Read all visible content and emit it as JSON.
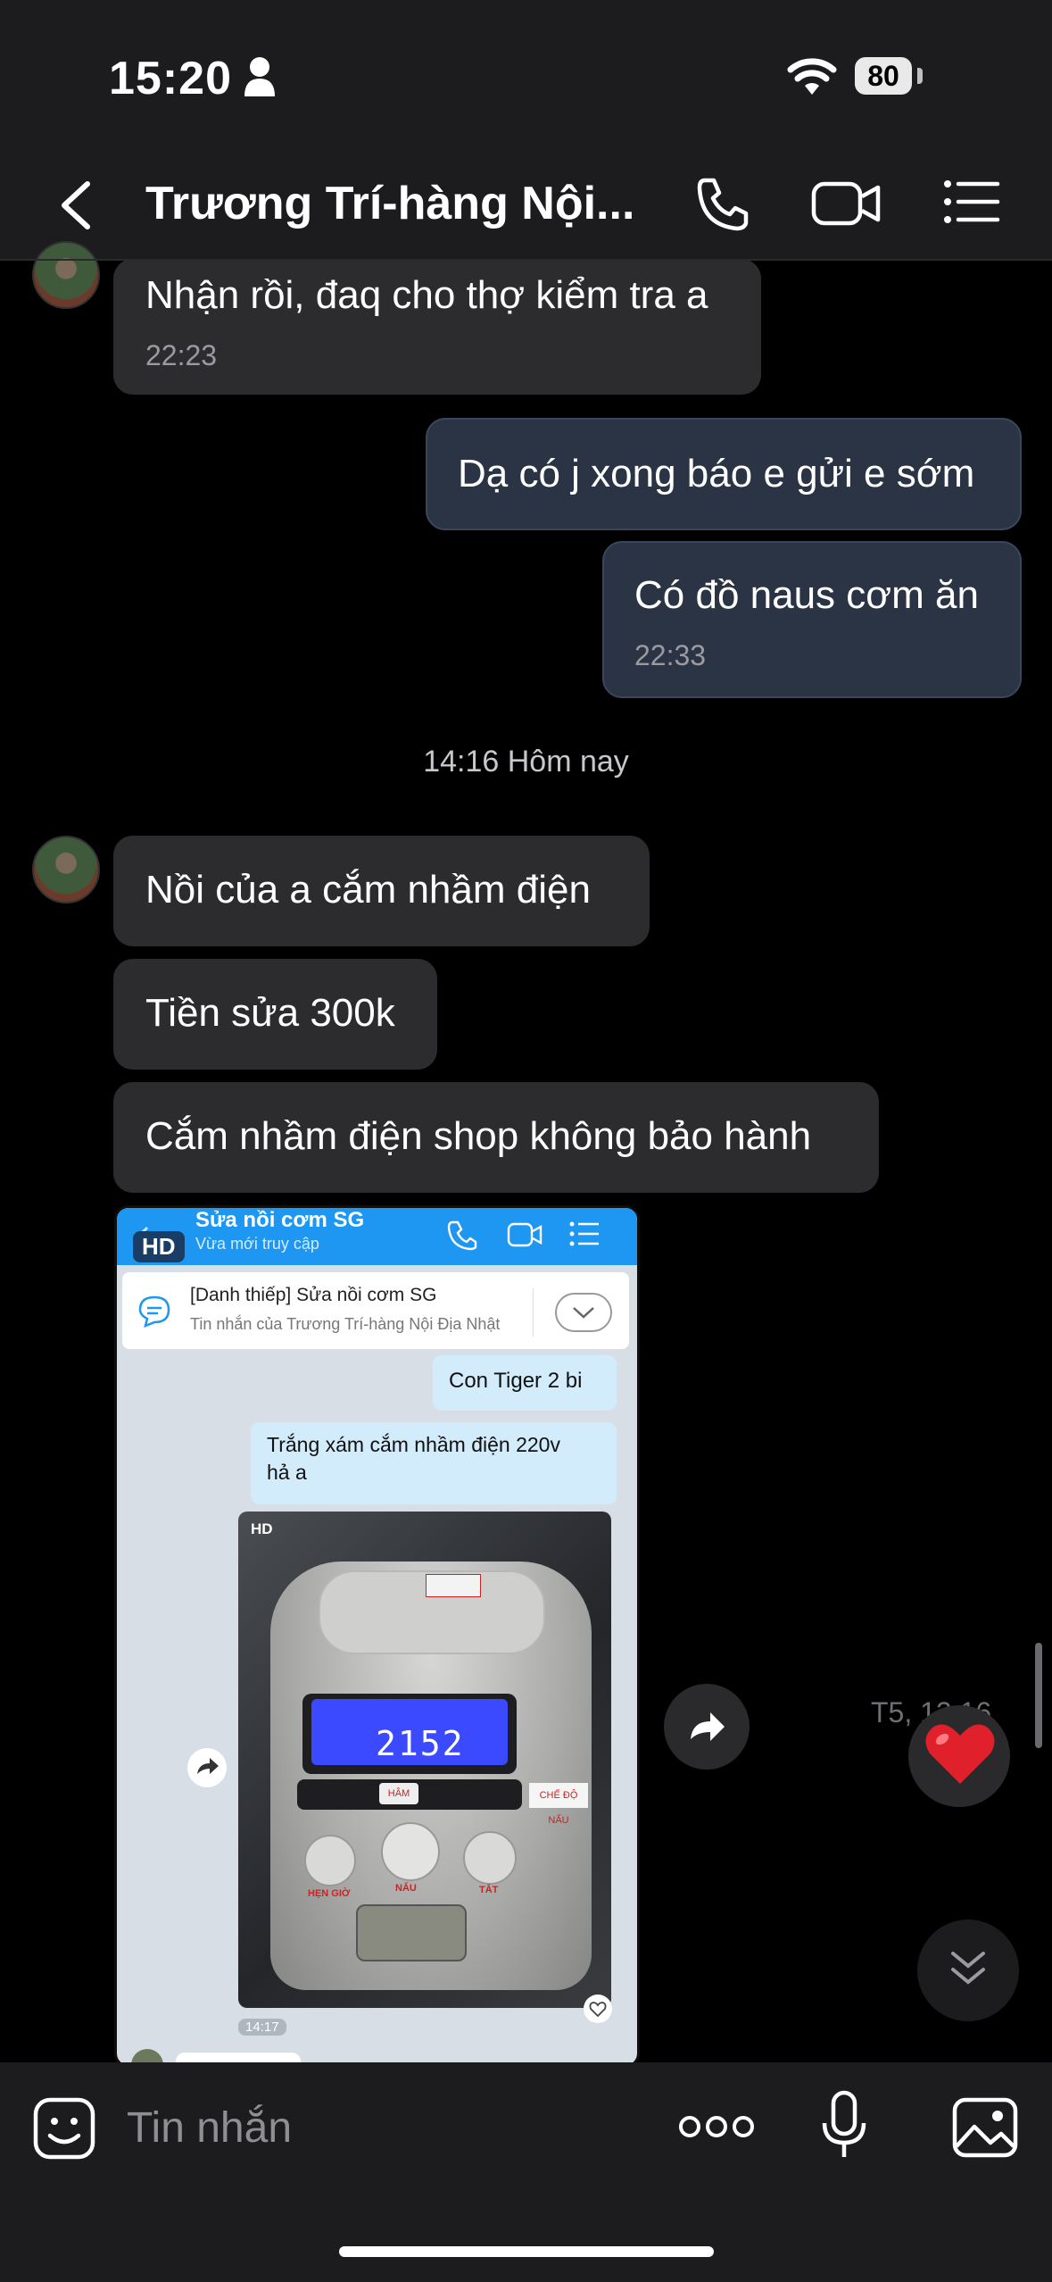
{
  "status_bar": {
    "time": "15:20",
    "battery": "80"
  },
  "header": {
    "title": "Trương Trí-hàng Nội..."
  },
  "messages": [
    {
      "side": "in",
      "text": "Nhận rồi, đaq cho thợ kiểm tra a",
      "time": "22:23"
    },
    {
      "side": "out",
      "text": "Dạ có j xong báo e gửi e sớm"
    },
    {
      "side": "out",
      "text": "Có đồ naus cơm ăn",
      "time": "22:33"
    },
    {
      "side": "in",
      "text": "Nồi của a cắm nhầm điện"
    },
    {
      "side": "in",
      "text": "Tiền sửa 300k"
    },
    {
      "side": "in",
      "text": "Cắm nhầm điện shop không bảo hành"
    }
  ],
  "separator": "14:16 Hôm nay",
  "image_message": {
    "hd_label": "HD",
    "inner": {
      "contact_name": "Sửa nồi cơm SG",
      "contact_status": "Vừa mới truy cập",
      "card_title": "[Danh thiếp] Sửa nồi cơm SG",
      "card_subtitle": "Tin nhắn của Trương Trí-hàng Nội Địa Nhật",
      "msg1": "Con Tiger 2 bi",
      "msg2_line1": "Trắng xám cắm nhầm điện 220v",
      "msg2_line2": "hả a",
      "photo_hd": "HD",
      "display": "2152",
      "label_left": "HẸN GIỜ",
      "label_mid": "NẤU",
      "label_right": "TẮT",
      "label_mode": "CHẾ ĐỘ NẤU",
      "label_keep": "HÂM",
      "photo_time": "14:17"
    },
    "side_time": "T5, 12:16"
  },
  "input": {
    "placeholder": "Tin nhắn"
  },
  "colors": {
    "accent": "#1e97f3",
    "heart": "#e0202a"
  }
}
